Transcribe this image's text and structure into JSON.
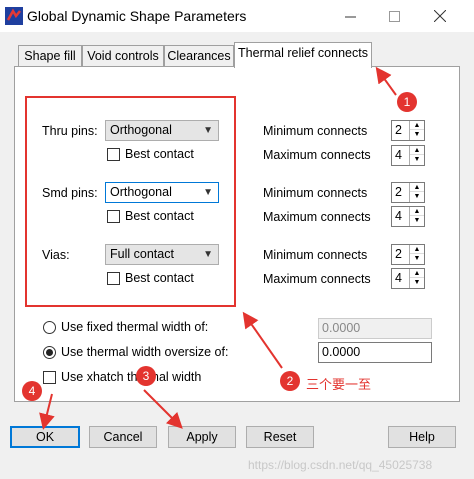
{
  "window": {
    "title": "Global Dynamic Shape Parameters",
    "app_icon": "app-icon",
    "minimize_icon": "minimize-icon",
    "maximize_icon": "maximize-icon",
    "close_icon": "close-icon"
  },
  "tabs": [
    {
      "label": "Shape fill"
    },
    {
      "label": "Void controls"
    },
    {
      "label": "Clearances"
    },
    {
      "label": "Thermal relief connects",
      "active": true
    }
  ],
  "rows": [
    {
      "label": "Thru pins:",
      "type": "Orthogonal",
      "best_contact": "Best contact",
      "min_label": "Minimum connects",
      "min_value": "2",
      "max_label": "Maximum connects",
      "max_value": "4"
    },
    {
      "label": "Smd pins:",
      "type": "Orthogonal",
      "best_contact": "Best contact",
      "min_label": "Minimum connects",
      "min_value": "2",
      "max_label": "Maximum connects",
      "max_value": "4"
    },
    {
      "label": "Vias:",
      "type": "Full contact",
      "best_contact": "Best contact",
      "min_label": "Minimum connects",
      "min_value": "2",
      "max_label": "Maximum connects",
      "max_value": "4"
    }
  ],
  "thermal_width": {
    "fixed_label": "Use fixed thermal width of:",
    "fixed_value": "0.0000",
    "oversize_label": "Use thermal width oversize of:",
    "oversize_value": "0.0000",
    "xhatch_label": "Use xhatch thermal width"
  },
  "buttons": {
    "ok": "OK",
    "cancel": "Cancel",
    "apply": "Apply",
    "reset": "Reset",
    "help": "Help"
  },
  "annotations": {
    "badge_1": "1",
    "badge_2": "2",
    "badge_3": "3",
    "badge_4": "4",
    "note": "三个要一至",
    "color": "#e3342f"
  },
  "watermark": "https://blog.csdn.net/qq_45025738"
}
